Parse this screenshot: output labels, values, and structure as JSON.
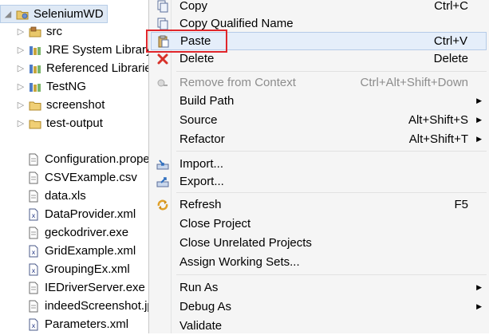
{
  "explorer": {
    "project": {
      "label": "SeleniumWD",
      "icon": "project-icon",
      "expander": "expanded"
    },
    "folders": [
      {
        "label": "src",
        "icon": "package-folder-icon"
      },
      {
        "label": "JRE System Library [",
        "icon": "library-icon"
      },
      {
        "label": "Referenced Librarie",
        "icon": "library-icon"
      },
      {
        "label": "TestNG",
        "icon": "library-icon"
      },
      {
        "label": "screenshot",
        "icon": "folder-icon"
      },
      {
        "label": "test-output",
        "icon": "folder-icon"
      }
    ],
    "files": [
      {
        "label": "Configuration.prope",
        "icon": "file-icon"
      },
      {
        "label": "CSVExample.csv",
        "icon": "file-icon"
      },
      {
        "label": "data.xls",
        "icon": "file-icon"
      },
      {
        "label": "DataProvider.xml",
        "icon": "xml-file-icon"
      },
      {
        "label": "geckodriver.exe",
        "icon": "file-icon"
      },
      {
        "label": "GridExample.xml",
        "icon": "xml-file-icon"
      },
      {
        "label": "GroupingEx.xml",
        "icon": "xml-file-icon"
      },
      {
        "label": "IEDriverServer.exe",
        "icon": "file-icon"
      },
      {
        "label": "indeedScreenshot.jp",
        "icon": "file-icon"
      },
      {
        "label": "Parameters.xml",
        "icon": "xml-file-icon"
      }
    ]
  },
  "menu": {
    "items": [
      {
        "label": "Copy",
        "shortcut": "Ctrl+C",
        "icon": "copy-icon"
      },
      {
        "label": "Copy Qualified Name",
        "shortcut": "",
        "icon": "copy-icon"
      },
      {
        "label": "Paste",
        "shortcut": "Ctrl+V",
        "icon": "paste-icon"
      },
      {
        "label": "Delete",
        "shortcut": "Delete",
        "icon": "delete-icon"
      },
      {
        "label": "Remove from Context",
        "shortcut": "Ctrl+Alt+Shift+Down",
        "icon": "remove-context-icon"
      },
      {
        "label": "Build Path",
        "shortcut": "",
        "icon": ""
      },
      {
        "label": "Source",
        "shortcut": "Alt+Shift+S",
        "icon": ""
      },
      {
        "label": "Refactor",
        "shortcut": "Alt+Shift+T",
        "icon": ""
      },
      {
        "label": "Import...",
        "shortcut": "",
        "icon": "import-icon"
      },
      {
        "label": "Export...",
        "shortcut": "",
        "icon": "export-icon"
      },
      {
        "label": "Refresh",
        "shortcut": "F5",
        "icon": "refresh-icon"
      },
      {
        "label": "Close Project",
        "shortcut": "",
        "icon": ""
      },
      {
        "label": "Close Unrelated Projects",
        "shortcut": "",
        "icon": ""
      },
      {
        "label": "Assign Working Sets...",
        "shortcut": "",
        "icon": ""
      },
      {
        "label": "Run As",
        "shortcut": "",
        "icon": ""
      },
      {
        "label": "Debug As",
        "shortcut": "",
        "icon": ""
      },
      {
        "label": "Validate",
        "shortcut": "",
        "icon": ""
      }
    ],
    "highlighted_item": "Paste",
    "disabled_item": "Remove from Context"
  },
  "colors": {
    "annotation_box": "#e0262b",
    "menu_background": "#f5f5f5",
    "highlight_background": "#e5eefa"
  }
}
